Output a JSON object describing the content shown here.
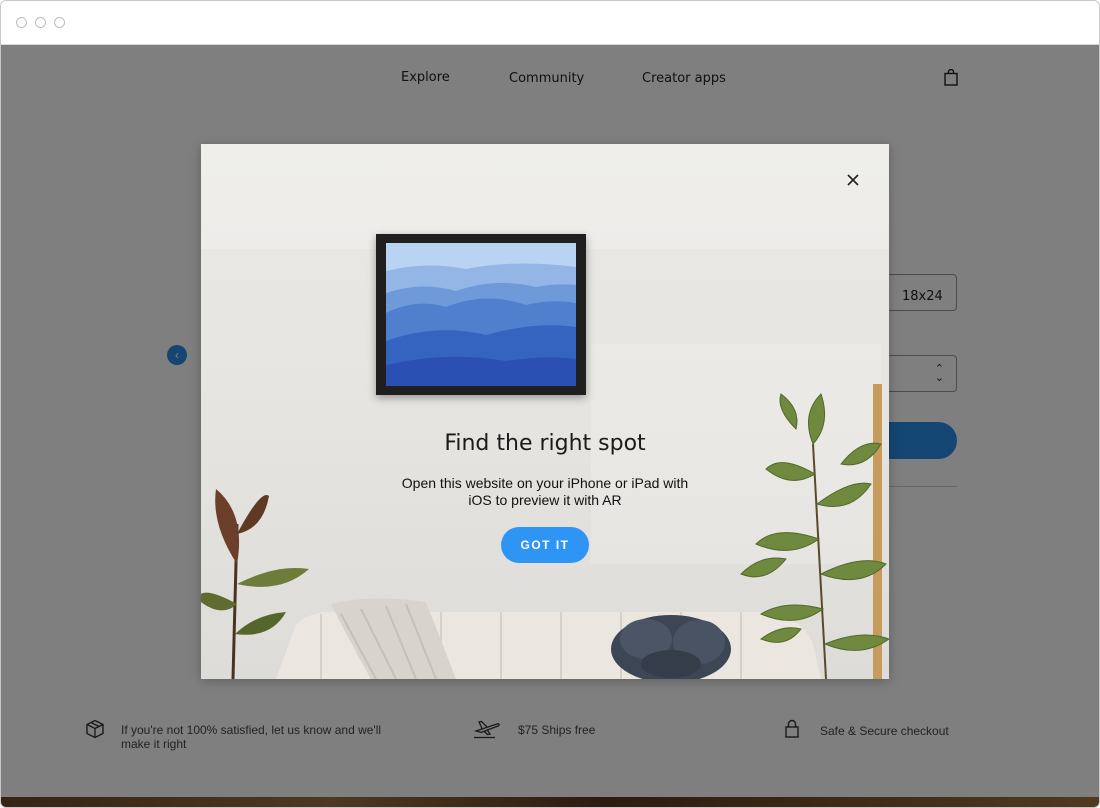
{
  "nav": {
    "items": [
      "Explore",
      "Community",
      "Creator apps"
    ]
  },
  "product": {
    "size_option": "18x24"
  },
  "features": [
    {
      "icon": "box-icon",
      "text_line1": "If you're not 100% satisfied, let us know and we'll",
      "text_line2": "make it right"
    },
    {
      "icon": "plane-icon",
      "text_line1": "$75 Ships free"
    },
    {
      "icon": "lock-icon",
      "text_line1": "Safe & Secure checkout"
    }
  ],
  "modal": {
    "title": "Find the right spot",
    "text_line1": "Open this website on your iPhone or iPad with",
    "text_line2": "iOS to preview it with AR",
    "button_label": "GOT IT"
  },
  "colors": {
    "accent": "#2f95f5",
    "overlay": "rgba(0,0,0,0.5)"
  }
}
